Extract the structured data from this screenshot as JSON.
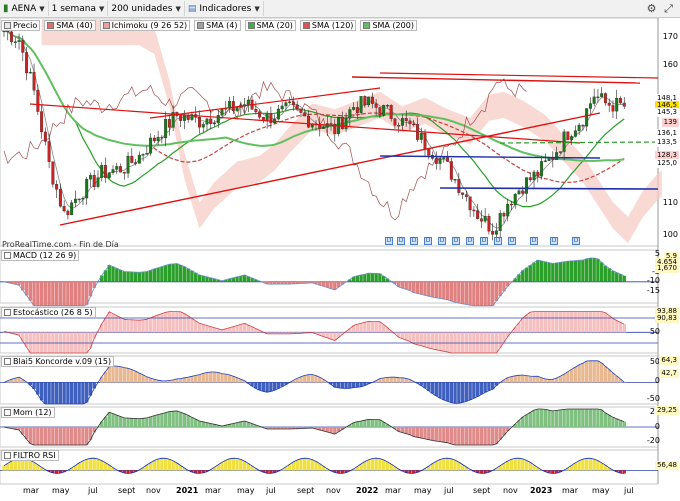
{
  "toolbar": {
    "symbol": "AENA",
    "period": "1 semana",
    "units": "200 unidades",
    "indicators": "Indicadores"
  },
  "main": {
    "legend": [
      {
        "label": "Precio",
        "color": "#e8e8e8"
      },
      {
        "label": "SMA (40)",
        "color": "#e07070"
      },
      {
        "label": "Ichimoku (9 26 52)",
        "color": "#f0a0a0"
      },
      {
        "label": "SMA (4)",
        "color": "#a0a0a0"
      },
      {
        "label": "SMA (20)",
        "color": "#40b040"
      },
      {
        "label": "SMA (120)",
        "color": "#e05050"
      },
      {
        "label": "SMA (200)",
        "color": "#60c060"
      }
    ],
    "y_ticks": [
      "170",
      "160",
      "110",
      "100"
    ],
    "price_tags": [
      {
        "text": "148,1",
        "bg": "#ffffff"
      },
      {
        "text": "146,5",
        "bg": "#ffe000"
      },
      {
        "text": "145,3",
        "bg": "#ffffff"
      },
      {
        "text": "139",
        "bg": "#ffd0d0"
      },
      {
        "text": "136,1",
        "bg": "#ffffff"
      },
      {
        "text": "133,5",
        "bg": "#ffffff"
      },
      {
        "text": "128,3",
        "bg": "#ffd0d0"
      },
      {
        "text": "125,0",
        "bg": "#ffffff"
      }
    ],
    "source": "ProRealTime.com - Fin de Día"
  },
  "panels": {
    "macd": {
      "label": "MACD (12 26 9)",
      "tags": [
        "5,9",
        "4,654",
        "1,670"
      ],
      "ticks": [
        "5",
        "0",
        "-5",
        "-10",
        "-15"
      ]
    },
    "stoch": {
      "label": "Estocástico (26 8 5)",
      "tags": [
        "93,88",
        "90,83"
      ],
      "ticks": [
        "50"
      ]
    },
    "blai5": {
      "label": "Blai5 Koncorde v.09 (15)",
      "tags": [
        "64,3",
        "42,7"
      ],
      "ticks": [
        "50",
        "0",
        "-50"
      ]
    },
    "mom": {
      "label": "Mom (12)",
      "tags": [
        "29,25"
      ],
      "ticks": [
        "20",
        "0",
        "-20"
      ]
    },
    "rsi": {
      "label": "FILTRO RSI",
      "tags": [
        "56,48"
      ],
      "ticks": []
    }
  },
  "x_axis": [
    {
      "label": "mar",
      "year": false
    },
    {
      "label": "may",
      "year": false
    },
    {
      "label": "jul",
      "year": false
    },
    {
      "label": "sept",
      "year": false
    },
    {
      "label": "nov",
      "year": false
    },
    {
      "label": "2021",
      "year": true
    },
    {
      "label": "mar",
      "year": false
    },
    {
      "label": "may",
      "year": false
    },
    {
      "label": "jul",
      "year": false
    },
    {
      "label": "sept",
      "year": false
    },
    {
      "label": "nov",
      "year": false
    },
    {
      "label": "2022",
      "year": true
    },
    {
      "label": "mar",
      "year": false
    },
    {
      "label": "may",
      "year": false
    },
    {
      "label": "jul",
      "year": false
    },
    {
      "label": "sept",
      "year": false
    },
    {
      "label": "nov",
      "year": false
    },
    {
      "label": "2023",
      "year": true
    },
    {
      "label": "mar",
      "year": false
    },
    {
      "label": "may",
      "year": false
    },
    {
      "label": "jul",
      "year": false
    }
  ],
  "event_marker": "D",
  "colors": {
    "up": "#1a7a1a",
    "down": "#cc2222",
    "trend": "#dd1111",
    "support": "#1f2fa8",
    "cloud": "#f7c9c0"
  }
}
